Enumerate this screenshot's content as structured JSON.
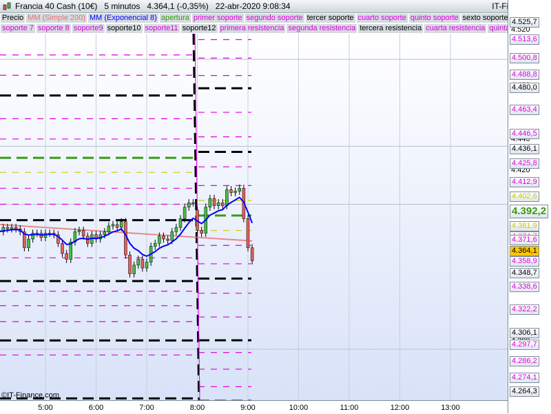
{
  "header": {
    "title": "Francia 40 Cash (10€)   5 minutos   4.364,1 (-0,35%)   22-abr-2020 9:08:34",
    "brand": "IT-Finance.com"
  },
  "legend_row1": [
    {
      "label": "Precio",
      "color": "#000000"
    },
    {
      "label": "MM (Simple 200)",
      "color": "#e87070"
    },
    {
      "label": "MM (Exponencial 8)",
      "color": "#0000ff"
    },
    {
      "label": "apertura",
      "color": "#3a9a10"
    },
    {
      "label": "primer soporte",
      "color": "#dd00dd"
    },
    {
      "label": "segundo soporte",
      "color": "#dd00dd"
    },
    {
      "label": "tercer soporte",
      "color": "#000000"
    },
    {
      "label": "cuarto soporte",
      "color": "#dd00dd"
    },
    {
      "label": "quinto soporte",
      "color": "#dd00dd"
    },
    {
      "label": "sexto soporte",
      "color": "#000000"
    }
  ],
  "legend_row2": [
    {
      "label": "soporte 7",
      "color": "#dd00dd"
    },
    {
      "label": "soporte 8",
      "color": "#dd00dd"
    },
    {
      "label": "soporte9",
      "color": "#dd00dd"
    },
    {
      "label": "soporte10",
      "color": "#000000"
    },
    {
      "label": "soporte11",
      "color": "#dd00dd"
    },
    {
      "label": "soporte12",
      "color": "#000000"
    },
    {
      "label": "primera resistencia",
      "color": "#dd00dd"
    },
    {
      "label": "segunda resistencia",
      "color": "#dd00dd"
    },
    {
      "label": "tercera resistencia",
      "color": "#000000"
    },
    {
      "label": "cuarta resistencia",
      "color": "#dd00dd"
    },
    {
      "label": "quinta resistencia",
      "color": "#dd00dd"
    }
  ],
  "price_ticks": [
    "4.520",
    "4.480",
    "4.440",
    "4.420",
    "4.400",
    "4.300",
    "4.280"
  ],
  "price_labels": [
    {
      "text": "4.525,7",
      "color": "#000000"
    },
    {
      "text": "4.513,6",
      "color": "#dd00dd"
    },
    {
      "text": "4.500,8",
      "color": "#dd00dd"
    },
    {
      "text": "4.488,8",
      "color": "#dd00dd"
    },
    {
      "text": "4.480,0",
      "color": "#000000"
    },
    {
      "text": "4.463,4",
      "color": "#dd00dd"
    },
    {
      "text": "4.446,5",
      "color": "#dd00dd"
    },
    {
      "text": "4.436,1",
      "color": "#000000"
    },
    {
      "text": "4.425,8",
      "color": "#dd00dd"
    },
    {
      "text": "4.412,9",
      "color": "#dd00dd"
    },
    {
      "text": "4.402,6",
      "color": "#cccc00"
    },
    {
      "text": "4.392,2",
      "color": "#3a9a10"
    },
    {
      "text": "4.381,9",
      "color": "#cccc00"
    },
    {
      "text": "4.374,7",
      "color": "#e87070"
    },
    {
      "text": "4.371,6",
      "color": "#dd00dd"
    },
    {
      "text": "4.364,1",
      "color": "#000000"
    },
    {
      "text": "4.358,9",
      "color": "#dd00dd"
    },
    {
      "text": "4.348,7",
      "color": "#000000"
    },
    {
      "text": "4.338,6",
      "color": "#dd00dd"
    },
    {
      "text": "4.322,2",
      "color": "#dd00dd"
    },
    {
      "text": "4.306,1",
      "color": "#000000"
    },
    {
      "text": "4.297,7",
      "color": "#dd00dd"
    },
    {
      "text": "4.286,2",
      "color": "#dd00dd"
    },
    {
      "text": "4.274,1",
      "color": "#dd00dd"
    },
    {
      "text": "4.264,3",
      "color": "#000000"
    }
  ],
  "time_labels": [
    "5:00",
    "6:00",
    "7:00",
    "8:00",
    "9:00",
    "10:00",
    "11:00",
    "12:00",
    "13:00"
  ],
  "copyright": "©IT-Finance.com",
  "chart_data": {
    "type": "candlestick",
    "interval": "5 minutos",
    "closes_prev_session": [
      4381,
      4384,
      4383,
      4384,
      4383,
      4381,
      4370,
      4376,
      4380,
      4380,
      4377,
      4380,
      4380,
      4379,
      4373,
      4366,
      4362,
      4374,
      4381,
      4382,
      4378,
      4373,
      4379,
      4376,
      4379,
      4381,
      4385,
      4386,
      4384,
      4388,
      4365,
      4352,
      4358,
      4362,
      4356,
      4360,
      4371,
      4373,
      4378,
      4376,
      4375,
      4381,
      4384,
      4390,
      4398,
      4401,
      4401
    ],
    "closes_session": [
      4382,
      4380,
      4398,
      4404,
      4399,
      4401,
      4399,
      4410,
      4408,
      4409,
      4411,
      4390,
      4370,
      4361
    ],
    "sma200": [
      4386,
      4374.7
    ],
    "levels_prev": [
      {
        "p": 4503,
        "c": "#dd00dd"
      },
      {
        "p": 4489,
        "c": "#dd00dd"
      },
      {
        "p": 4475,
        "c": "#000000"
      },
      {
        "p": 4459,
        "c": "#dd00dd"
      },
      {
        "p": 4445,
        "c": "#dd00dd"
      },
      {
        "p": 4432,
        "c": "#3a9a10"
      },
      {
        "p": 4422,
        "c": "#cccc00"
      },
      {
        "p": 4411,
        "c": "#dd00dd"
      },
      {
        "p": 4400,
        "c": "#dd00dd"
      },
      {
        "p": 4389,
        "c": "#000000"
      },
      {
        "p": 4363,
        "c": "#dd00dd"
      },
      {
        "p": 4347,
        "c": "#000000"
      },
      {
        "p": 4340,
        "c": "#dd00dd"
      },
      {
        "p": 4330,
        "c": "#dd00dd"
      },
      {
        "p": 4319,
        "c": "#dd00dd"
      },
      {
        "p": 4306,
        "c": "#000000"
      },
      {
        "p": 4296,
        "c": "#dd00dd"
      },
      {
        "p": 4266,
        "c": "#000000"
      }
    ],
    "levels_session": [
      {
        "p": 4513.6,
        "c": "#dd00dd"
      },
      {
        "p": 4500.8,
        "c": "#dd00dd"
      },
      {
        "p": 4488.8,
        "c": "#dd00dd"
      },
      {
        "p": 4480.0,
        "c": "#000000"
      },
      {
        "p": 4463.4,
        "c": "#dd00dd"
      },
      {
        "p": 4446.5,
        "c": "#dd00dd"
      },
      {
        "p": 4436.1,
        "c": "#000000"
      },
      {
        "p": 4425.8,
        "c": "#dd00dd"
      },
      {
        "p": 4412.9,
        "c": "#dd00dd"
      },
      {
        "p": 4402.6,
        "c": "#cccc00"
      },
      {
        "p": 4392.2,
        "c": "#3a9a10"
      },
      {
        "p": 4381.9,
        "c": "#cccc00"
      },
      {
        "p": 4371.6,
        "c": "#dd00dd"
      },
      {
        "p": 4358.9,
        "c": "#dd00dd"
      },
      {
        "p": 4348.7,
        "c": "#000000"
      },
      {
        "p": 4338.6,
        "c": "#dd00dd"
      },
      {
        "p": 4322.2,
        "c": "#dd00dd"
      },
      {
        "p": 4306.1,
        "c": "#000000"
      },
      {
        "p": 4297.7,
        "c": "#dd00dd"
      },
      {
        "p": 4286.2,
        "c": "#dd00dd"
      },
      {
        "p": 4274.1,
        "c": "#dd00dd"
      },
      {
        "p": 4264.3,
        "c": "#000000"
      }
    ]
  }
}
